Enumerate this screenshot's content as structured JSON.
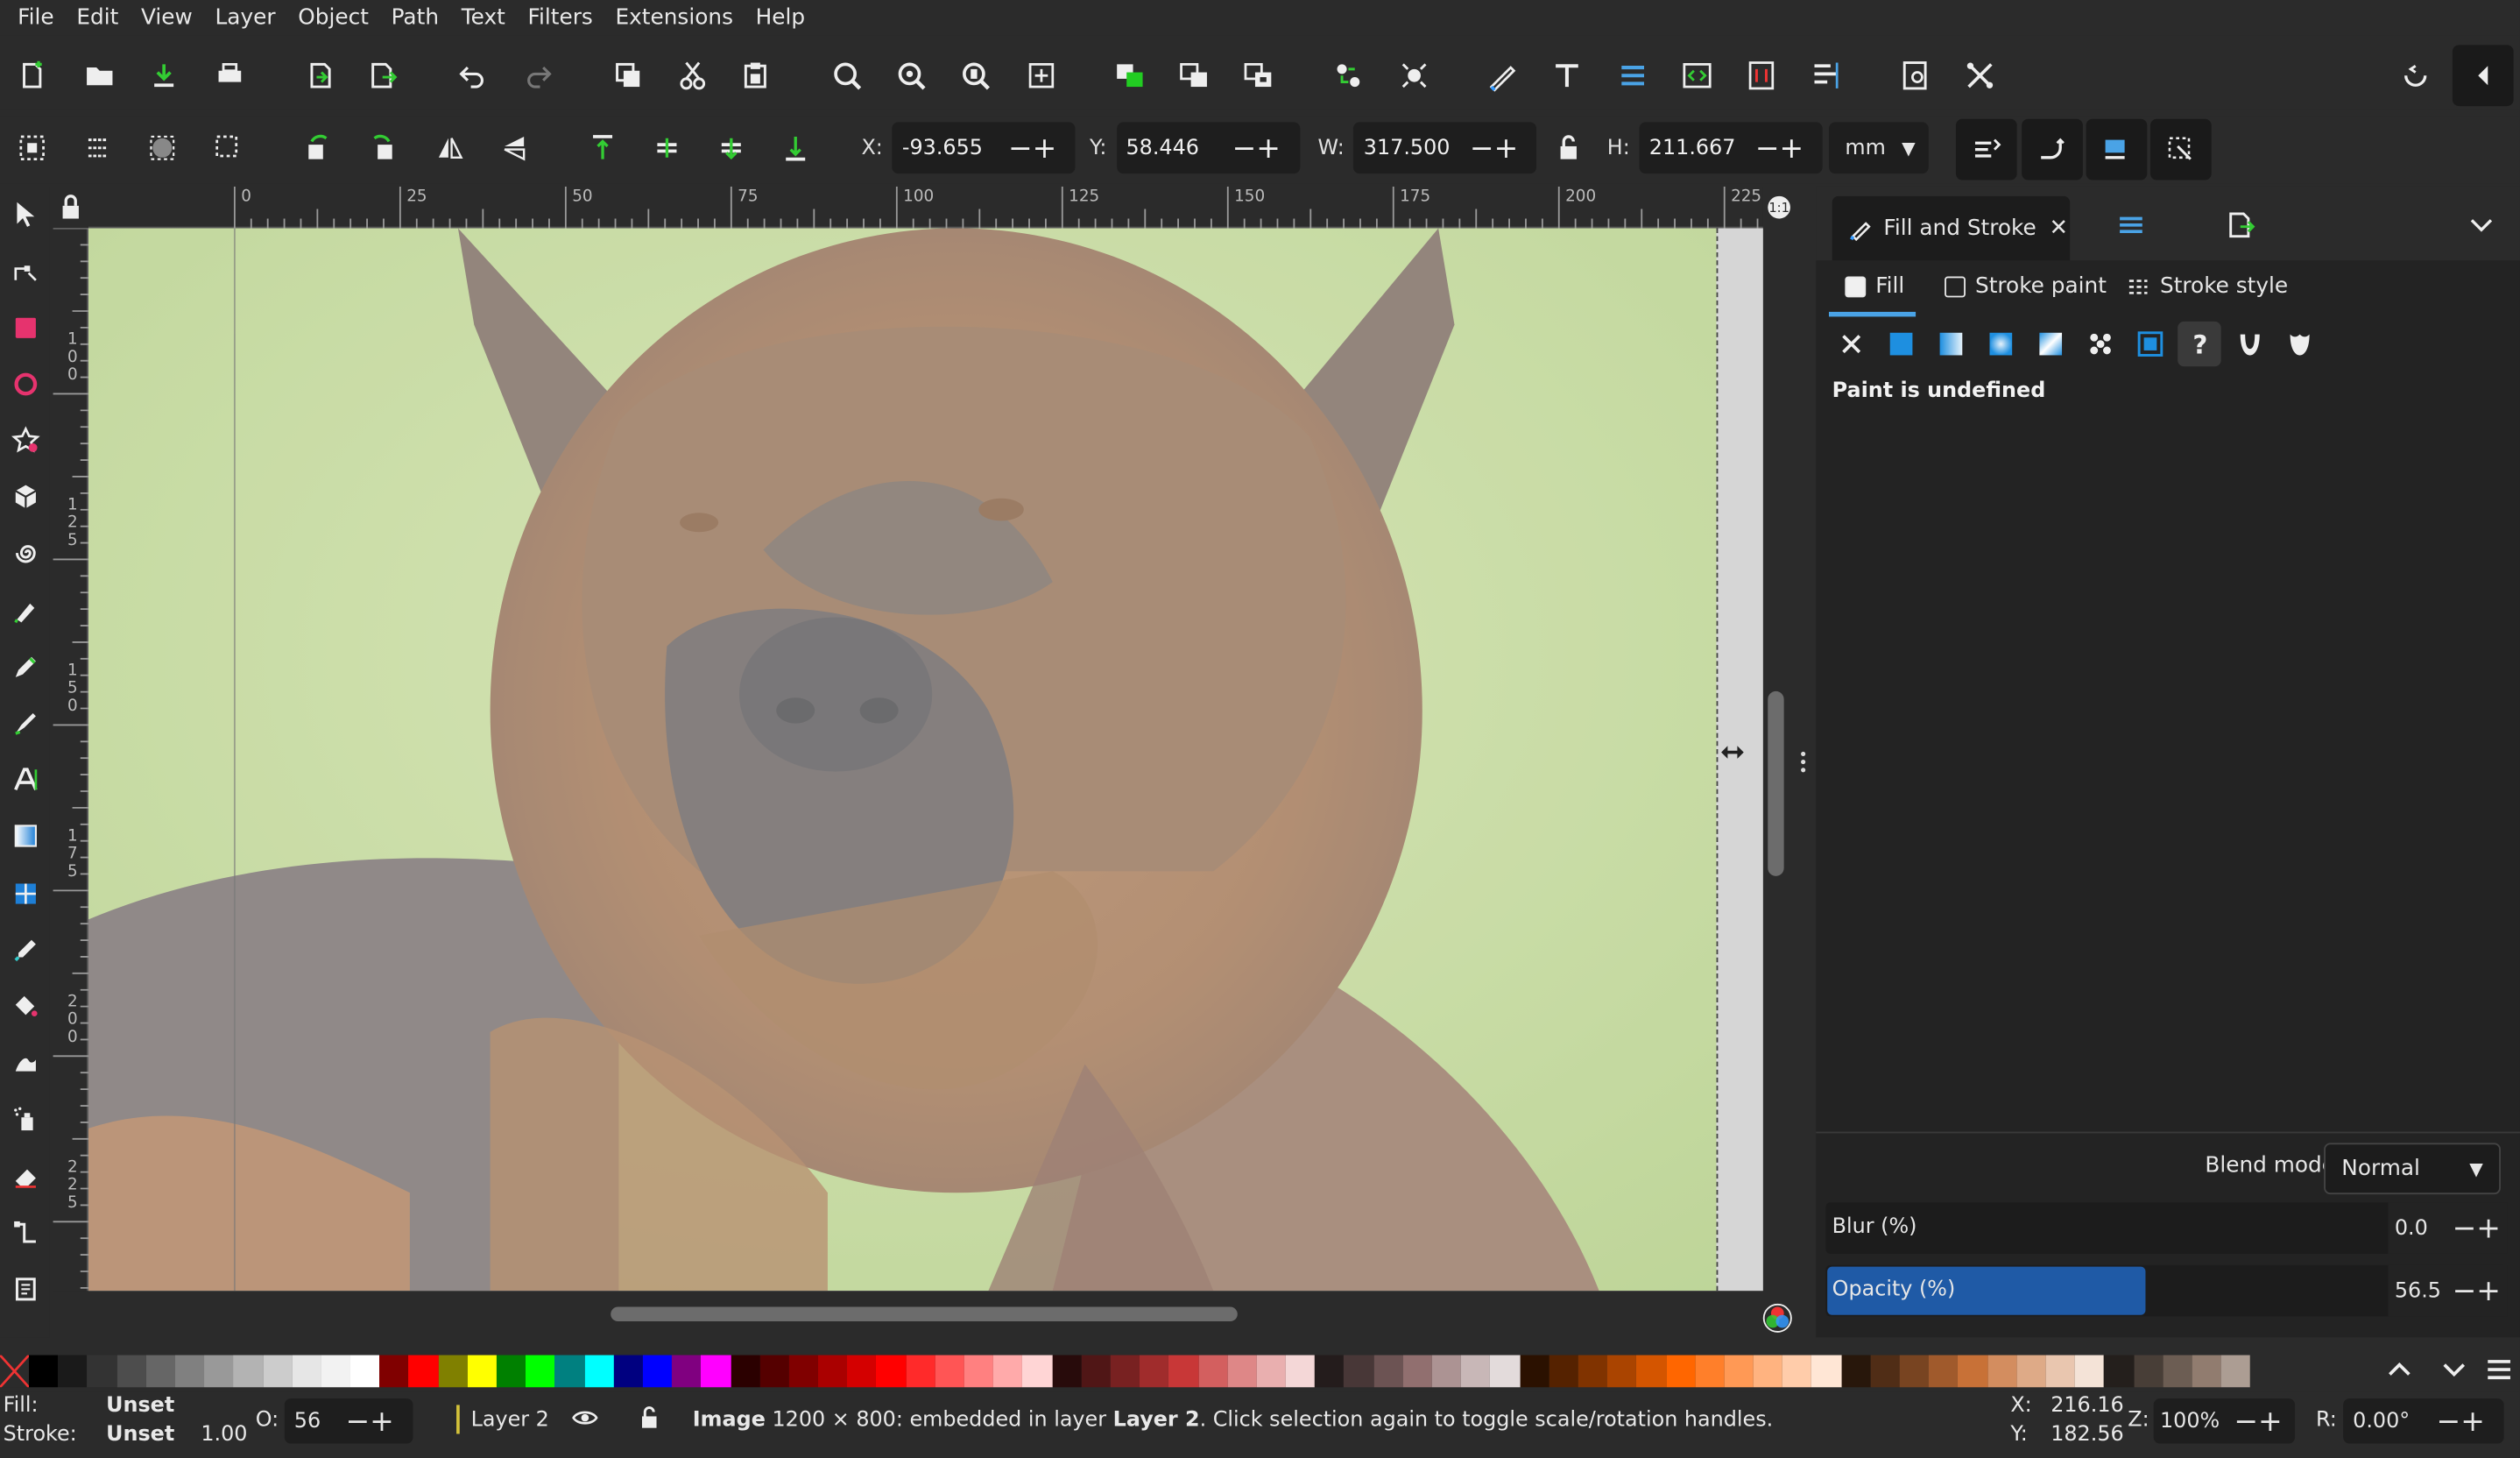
{
  "menubar": {
    "items": [
      "File",
      "Edit",
      "View",
      "Layer",
      "Object",
      "Path",
      "Text",
      "Filters",
      "Extensions",
      "Help"
    ]
  },
  "commands_bar": {
    "icons": [
      "new-document-icon",
      "open-icon",
      "save-icon",
      "print-icon",
      "import-icon",
      "export-icon",
      "undo-icon",
      "redo-icon",
      "duplicate-icon",
      "cut-icon",
      "paste-icon",
      "zoom-selection-icon",
      "zoom-drawing-icon",
      "zoom-page-icon",
      "zoom-center-icon",
      "group-icon",
      "ungroup-icon",
      "clone-icon",
      "unlink-clone-icon",
      "select-same-icon",
      "node-editor-icon",
      "text-font-icon",
      "layers-icon",
      "xml-editor-icon",
      "selectors-icon",
      "align-distribute-icon",
      "document-properties-icon",
      "preferences-icon",
      "snap-icon",
      "collapse-icon"
    ]
  },
  "tool_controls": {
    "x_label": "X:",
    "x_value": "-93.655",
    "y_label": "Y:",
    "y_value": "58.446",
    "w_label": "W:",
    "w_value": "317.500",
    "h_label": "H:",
    "h_value": "211.667",
    "unit": "mm"
  },
  "ruler": {
    "h_ticks": [
      "0",
      "25",
      "50",
      "75",
      "100",
      "125",
      "150",
      "175",
      "200",
      "225"
    ],
    "v_ticks": [
      "1\n0\n0",
      "1\n2\n5",
      "1\n5\n0",
      "1\n7\n5",
      "2\n0\n0",
      "2\n2\n5"
    ]
  },
  "panel": {
    "tab_title": "Fill and Stroke",
    "subtabs": {
      "fill": "Fill",
      "stroke_paint": "Stroke paint",
      "stroke_style": "Stroke style"
    },
    "paint_status": "Paint is undefined",
    "blend_label": "Blend mode:",
    "blend_value": "Normal",
    "blur_label": "Blur (%)",
    "blur_value": "0.0",
    "opacity_label": "Opacity (%)",
    "opacity_value": "56.5",
    "opacity_fraction": 0.565
  },
  "palette": {
    "colors": [
      "#000000",
      "#1a1a1a",
      "#333333",
      "#4d4d4d",
      "#666666",
      "#808080",
      "#999999",
      "#b3b3b3",
      "#cccccc",
      "#e6e6e6",
      "#f2f2f2",
      "#ffffff",
      "#800000",
      "#ff0000",
      "#808000",
      "#ffff00",
      "#008000",
      "#00ff00",
      "#008080",
      "#00ffff",
      "#000080",
      "#0000ff",
      "#800080",
      "#ff00ff",
      "#2b0000",
      "#550000",
      "#800000",
      "#aa0000",
      "#d40000",
      "#ff0000",
      "#ff2a2a",
      "#ff5555",
      "#ff8080",
      "#ffaaaa",
      "#ffd5d5",
      "#280b0b",
      "#501616",
      "#782121",
      "#a02c2c",
      "#c83737",
      "#d35f5f",
      "#de8787",
      "#e9afaf",
      "#f4d7d7",
      "#241c1c",
      "#483737",
      "#6c5353",
      "#916f6f",
      "#ac9393",
      "#c8b7b7",
      "#e3dbdb",
      "#2b1100",
      "#552200",
      "#803300",
      "#aa4400",
      "#d45500",
      "#ff6600",
      "#ff7f2a",
      "#ff9955",
      "#ffb380",
      "#ffccaa",
      "#ffe6d5",
      "#28170b",
      "#502d16",
      "#784421",
      "#a05a2c",
      "#c87137",
      "#d38d5f",
      "#deaa87",
      "#e9c6af",
      "#f4e3d7",
      "#241f1c",
      "#483e37",
      "#6c5d53",
      "#917c6f",
      "#ac9d93"
    ]
  },
  "status": {
    "fill_label": "Fill:",
    "fill_value": "Unset",
    "stroke_label": "Stroke:",
    "stroke_value": "Unset",
    "stroke_width": "1.00",
    "opacity_label": "O:",
    "opacity_value": "56",
    "layer": "Layer 2",
    "message_bold": "Image",
    "message_mid": " 1200 × 800: embedded in layer ",
    "message_layer": "Layer 2",
    "message_tail": ". Click selection again to toggle scale/rotation handles.",
    "x_label": "X:",
    "x_value": "216.16",
    "y_label": "Y:",
    "y_value": "182.56",
    "zoom_label": "Z:",
    "zoom_value": "100%",
    "rotation_label": "R:",
    "rotation_value": "0.00°"
  }
}
